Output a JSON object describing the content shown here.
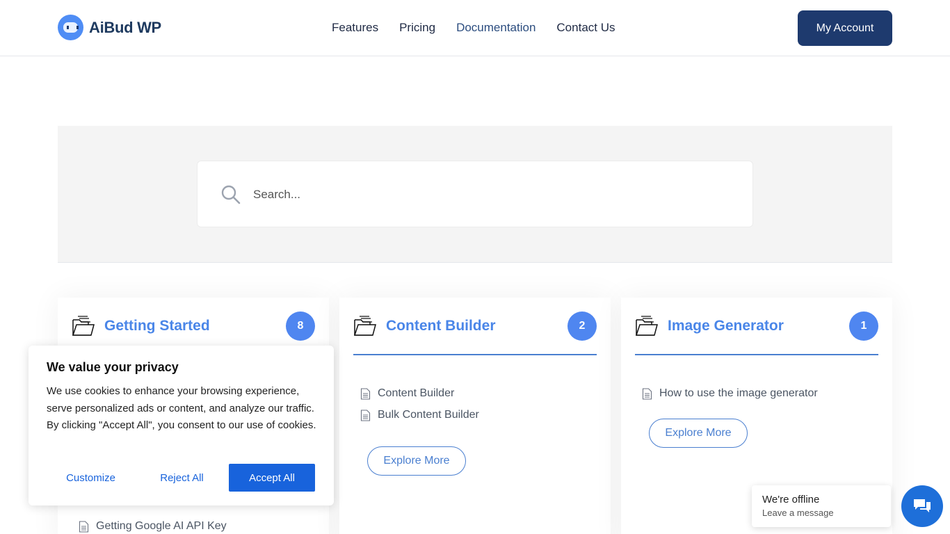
{
  "header": {
    "logo_text": "AiBud WP",
    "nav": [
      {
        "label": "Features"
      },
      {
        "label": "Pricing"
      },
      {
        "label": "Documentation"
      },
      {
        "label": "Contact Us"
      }
    ],
    "account_button": "My Account"
  },
  "search": {
    "placeholder": "Search..."
  },
  "cards": [
    {
      "title": "Getting Started",
      "count": "8",
      "items": [
        "Getting Google AI API Key"
      ]
    },
    {
      "title": "Content Builder",
      "count": "2",
      "items": [
        "Content Builder",
        "Bulk Content Builder"
      ],
      "explore": "Explore More"
    },
    {
      "title": "Image Generator",
      "count": "1",
      "items": [
        "How to use the image generator"
      ],
      "explore": "Explore More"
    }
  ],
  "cookie": {
    "title": "We value your privacy",
    "text": "We use cookies to enhance your browsing experience, serve personalized ads or content, and analyze our traffic. By clicking \"Accept All\", you consent to our use of cookies.",
    "customize": "Customize",
    "reject": "Reject All",
    "accept": "Accept All"
  },
  "chat": {
    "title": "We're offline",
    "subtitle": "Leave a message"
  },
  "colors": {
    "brand_navy": "#1e3a6e",
    "accent_blue": "#4a86e8",
    "cookie_blue": "#1863dc",
    "chat_blue": "#1e6fd9"
  }
}
